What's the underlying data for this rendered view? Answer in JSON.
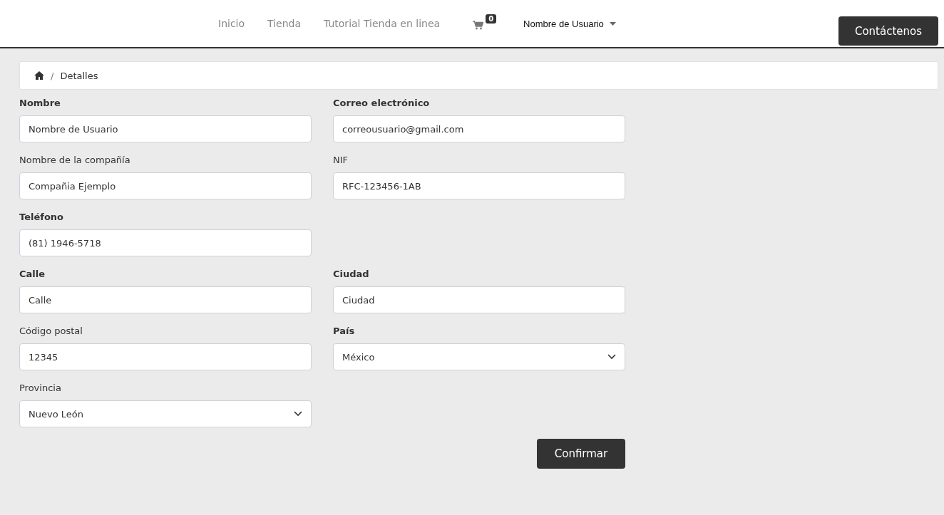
{
  "nav": {
    "links": [
      {
        "label": "Inicio"
      },
      {
        "label": "Tienda"
      },
      {
        "label": "Tutorial Tienda en linea"
      }
    ],
    "cart_count": "0",
    "user_menu": "Nombre de Usuario",
    "contact_button": "Contáctenos"
  },
  "breadcrumb": {
    "separator": "/",
    "current": "Detalles"
  },
  "form": {
    "rows": [
      {
        "fields": [
          {
            "label": "Nombre",
            "bold": true,
            "kind": "text",
            "value": "Nombre de Usuario"
          },
          {
            "label": "Correo electrónico",
            "bold": true,
            "kind": "text",
            "value": "correousuario@gmail.com"
          }
        ]
      },
      {
        "fields": [
          {
            "label": "Nombre de la compañía",
            "bold": false,
            "kind": "text",
            "value": "Compañia Ejemplo"
          },
          {
            "label": "NIF",
            "bold": false,
            "kind": "text",
            "value": "RFC-123456-1AB"
          }
        ]
      },
      {
        "fields": [
          {
            "label": "Teléfono",
            "bold": true,
            "kind": "text",
            "value": "(81) 1946-5718"
          }
        ]
      },
      {
        "fields": [
          {
            "label": "Calle",
            "bold": true,
            "kind": "text",
            "value": "Calle"
          },
          {
            "label": "Ciudad",
            "bold": true,
            "kind": "text",
            "value": "Ciudad"
          }
        ]
      },
      {
        "fields": [
          {
            "label": "Código postal",
            "bold": false,
            "kind": "text",
            "value": "12345"
          },
          {
            "label": "País",
            "bold": true,
            "kind": "select",
            "value": "México"
          }
        ]
      },
      {
        "fields": [
          {
            "label": "Provincia",
            "bold": false,
            "kind": "select",
            "value": "Nuevo León"
          }
        ]
      }
    ],
    "submit": "Confirmar"
  }
}
